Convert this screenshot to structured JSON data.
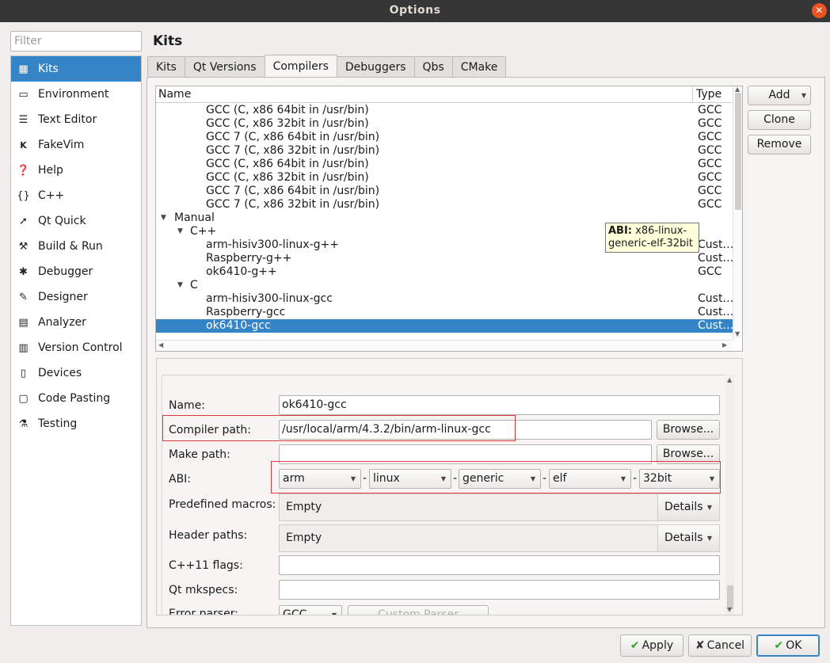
{
  "window": {
    "title": "Options",
    "close_icon": "close-icon"
  },
  "filter": {
    "placeholder": "Filter"
  },
  "sidebar": {
    "selected": "Kits",
    "items": [
      {
        "label": "Kits",
        "icon": "kits-icon"
      },
      {
        "label": "Environment",
        "icon": "monitor-icon"
      },
      {
        "label": "Text Editor",
        "icon": "text-editor-icon"
      },
      {
        "label": "FakeVim",
        "icon": "fakevim-icon"
      },
      {
        "label": "Help",
        "icon": "help-icon"
      },
      {
        "label": "C++",
        "icon": "braces-icon"
      },
      {
        "label": "Qt Quick",
        "icon": "qt-quick-icon"
      },
      {
        "label": "Build & Run",
        "icon": "hammer-icon"
      },
      {
        "label": "Debugger",
        "icon": "bug-icon"
      },
      {
        "label": "Designer",
        "icon": "pencil-icon"
      },
      {
        "label": "Analyzer",
        "icon": "analyzer-icon"
      },
      {
        "label": "Version Control",
        "icon": "version-control-icon"
      },
      {
        "label": "Devices",
        "icon": "devices-icon"
      },
      {
        "label": "Code Pasting",
        "icon": "paste-icon"
      },
      {
        "label": "Testing",
        "icon": "testing-icon"
      }
    ]
  },
  "page": {
    "title": "Kits"
  },
  "tabs": [
    {
      "label": "Kits"
    },
    {
      "label": "Qt Versions"
    },
    {
      "label": "Compilers",
      "active": true
    },
    {
      "label": "Debuggers"
    },
    {
      "label": "Qbs"
    },
    {
      "label": "CMake"
    }
  ],
  "compiler_tree": {
    "columns": [
      "Name",
      "Type"
    ],
    "rows": [
      {
        "name": "GCC (C, x86 64bit in /usr/bin)",
        "type": "GCC",
        "level": 2
      },
      {
        "name": "GCC (C, x86 32bit in /usr/bin)",
        "type": "GCC",
        "level": 2
      },
      {
        "name": "GCC 7 (C, x86 64bit in /usr/bin)",
        "type": "GCC",
        "level": 2
      },
      {
        "name": "GCC 7 (C, x86 32bit in /usr/bin)",
        "type": "GCC",
        "level": 2
      },
      {
        "name": "GCC (C, x86 64bit in /usr/bin)",
        "type": "GCC",
        "level": 2
      },
      {
        "name": "GCC (C, x86 32bit in /usr/bin)",
        "type": "GCC",
        "level": 2
      },
      {
        "name": "GCC 7 (C, x86 64bit in /usr/bin)",
        "type": "GCC",
        "level": 2
      },
      {
        "name": "GCC 7 (C, x86 32bit in /usr/bin)",
        "type": "GCC",
        "level": 2
      },
      {
        "name": "Manual",
        "type": "",
        "level": 0,
        "expanded": true
      },
      {
        "name": "C++",
        "type": "",
        "level": 1,
        "expanded": true
      },
      {
        "name": "arm-hisiv300-linux-g++",
        "type": "Cust…",
        "level": 2
      },
      {
        "name": "Raspberry-g++",
        "type": "Cust…",
        "level": 2
      },
      {
        "name": "ok6410-g++",
        "type": "GCC",
        "level": 2
      },
      {
        "name": "C",
        "type": "",
        "level": 1,
        "expanded": true
      },
      {
        "name": "arm-hisiv300-linux-gcc",
        "type": "Cust…",
        "level": 2
      },
      {
        "name": "Raspberry-gcc",
        "type": "Cust…",
        "level": 2
      },
      {
        "name": "ok6410-gcc",
        "type": "Cust…",
        "level": 2,
        "selected": true
      }
    ]
  },
  "tooltip": {
    "label": "ABI:",
    "text": "x86-linux-generic-elf-32bit"
  },
  "side_buttons": {
    "add": "Add",
    "clone": "Clone",
    "remove": "Remove"
  },
  "details": {
    "name_label": "Name:",
    "name_value": "ok6410-gcc",
    "compiler_path_label": "Compiler path:",
    "compiler_path_value": "/usr/local/arm/4.3.2/bin/arm-linux-gcc",
    "make_path_label": "Make path:",
    "make_path_value": "",
    "browse": "Browse...",
    "abi_label": "ABI:",
    "abi": [
      "arm",
      "linux",
      "generic",
      "elf",
      "32bit"
    ],
    "abi_sep": "-",
    "macros_label": "Predefined macros:",
    "macros_value": "Empty",
    "header_label": "Header paths:",
    "header_value": "Empty",
    "details_btn": "Details",
    "cxx11_label": "C++11 flags:",
    "cxx11_value": "",
    "mkspecs_label": "Qt mkspecs:",
    "mkspecs_value": "",
    "error_parser_label": "Error parser:",
    "error_parser_value": "GCC",
    "custom_parser": "Custom Parser Settings..."
  },
  "dialog_buttons": {
    "apply": "Apply",
    "cancel": "Cancel",
    "ok": "OK"
  },
  "colors": {
    "accent": "#3584c6",
    "highlight_box": "#e0383e",
    "titlebar": "#363636",
    "close": "#e95420"
  }
}
